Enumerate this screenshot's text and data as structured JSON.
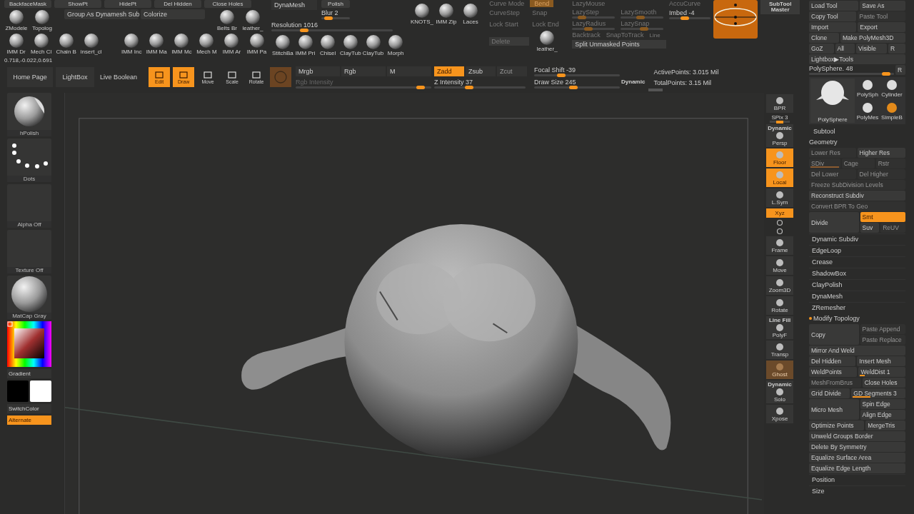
{
  "top_shelf": {
    "cut_buttons": [
      "BackfaceMask",
      "ShowPt",
      "HidePt",
      "Del Hidden",
      "Close Holes"
    ],
    "tiles_a": [
      "ZModele",
      "Topolog"
    ],
    "buttons": [
      "Group As Dynamesh Sub",
      "Colorize"
    ],
    "tiles_b": [
      "Belts Br",
      "leather_"
    ],
    "tiles_c": [
      "IMM Dr",
      "Mech Cl",
      "Chain B",
      "insert_cl"
    ],
    "tiles_d": [
      "IMM Inc",
      "IMM Ma",
      "IMM Mc",
      "Mech M",
      "IMM Ar",
      "IMM Pa"
    ],
    "coordinates": "0.718,-0.022,0.691"
  },
  "dynamesh": {
    "title": "DynaMesh",
    "polish": "Polish",
    "blur": {
      "label": "Blur 2",
      "level": 0.15
    },
    "resolution": {
      "label": "Resolution 1016",
      "level": 0.25
    },
    "brushes": [
      "StitchBa",
      "IMM Pri",
      "Chisel",
      "ClayTub",
      "ClayTub",
      "Morph"
    ]
  },
  "brushes_top": [
    "KNOTS_",
    "IMM Zip",
    "Laces"
  ],
  "stroke": {
    "curve_mode": "Curve Mode",
    "bend": {
      "label": "Bend",
      "on": true
    },
    "labels": [
      "CurveStep",
      "Snap",
      "Lock Start",
      "Lock End"
    ],
    "delete": "Delete",
    "tile": "leather_"
  },
  "lazy": {
    "title": "LazyMouse",
    "sliders": [
      {
        "label": "LazyStep",
        "level": 0.15
      },
      {
        "label": "LazySmooth",
        "level": 0.45
      },
      {
        "label": "LazyRadius",
        "level": 0.35
      },
      {
        "label": "LazySnap",
        "level": 0.55
      }
    ],
    "backtrack": "Backtrack",
    "snap_to_track": "SnapToTrack",
    "line": "Line",
    "split": "Split Unmasked Points"
  },
  "accucurve": "AccuCurve",
  "imbed": {
    "label": "Imbed -4",
    "level": 0.35
  },
  "subtool_master": "SubTool Master",
  "toolbar": {
    "home": "Home Page",
    "lightbox": "LightBox",
    "live_boolean": "Live Boolean",
    "modes": [
      {
        "label": "Edit",
        "on": true
      },
      {
        "label": "Draw",
        "on": true
      },
      {
        "label": "Move",
        "on": false
      },
      {
        "label": "Scale",
        "on": false
      },
      {
        "label": "Rotate",
        "on": false
      }
    ],
    "color_modes": [
      {
        "label": "Mrgb",
        "selected": false
      },
      {
        "label": "Rgb",
        "selected": false
      },
      {
        "label": "M",
        "selected": false
      }
    ],
    "rgb_intensity": {
      "label": "Rgb Intensity",
      "level": 0.95
    },
    "z_modes": [
      {
        "label": "Zadd",
        "selected": true
      },
      {
        "label": "Zsub",
        "selected": false
      },
      {
        "label": "Zcut",
        "selected": false
      }
    ],
    "z_intensity": {
      "label": "Z Intensity 37",
      "level": 0.37
    },
    "focal_shift": {
      "label": "Focal Shift -39",
      "level": 0.3
    },
    "draw_size": {
      "label": "Draw Size 245",
      "level": 0.45
    },
    "dynamic": "Dynamic",
    "active_points": "ActivePoints: 3.015 Mil",
    "total_points": "TotalPoints: 3.15 Mil"
  },
  "left_shelf": {
    "tiles": [
      {
        "kind": "brush",
        "label": "hPolish"
      },
      {
        "kind": "stroke",
        "label": "Dots"
      },
      {
        "kind": "alpha",
        "label": "Alpha Off"
      },
      {
        "kind": "texture",
        "label": "Texture Off"
      },
      {
        "kind": "material",
        "label": "MatCap Gray"
      }
    ],
    "gradient": "Gradient",
    "swatches": [
      {
        "color": "#000000"
      },
      {
        "color": "#ffffff"
      }
    ],
    "switch_color": "SwitchColor",
    "alternate": {
      "label": "Alternate",
      "on": true
    }
  },
  "right_shelf": [
    {
      "kind": "bpr",
      "label": "BPR",
      "on": false
    },
    {
      "kind": "slider",
      "label": "SPix 3",
      "level": 0.5
    },
    {
      "kind": "persp",
      "label": "Persp",
      "caption": "Dynamic",
      "on": false
    },
    {
      "kind": "floor",
      "label": "Floor",
      "on": true
    },
    {
      "kind": "local",
      "label": "Local",
      "on": true
    },
    {
      "kind": "lsym",
      "label": "L.Sym",
      "on": false
    },
    {
      "kind": "xyz",
      "label": "Xyz",
      "on": true
    },
    {
      "kind": "rot",
      "on": false
    },
    {
      "kind": "rot",
      "on": false
    },
    {
      "kind": "frame",
      "label": "Frame",
      "on": false
    },
    {
      "kind": "move",
      "label": "Move",
      "on": false
    },
    {
      "kind": "zoom",
      "label": "Zoom3D",
      "on": false
    },
    {
      "kind": "rotate",
      "label": "Rotate",
      "on": false
    },
    {
      "kind": "polyf",
      "label": "PolyF",
      "caption": "Line Fill",
      "on": false
    },
    {
      "kind": "transp",
      "label": "Transp",
      "on": false
    },
    {
      "kind": "ghost",
      "label": "Ghost",
      "on": true
    },
    {
      "kind": "solo",
      "label": "Solo",
      "caption": "Dynamic",
      "on": false
    },
    {
      "kind": "xpose",
      "label": "Xpose",
      "on": false
    }
  ],
  "tool_panel": {
    "rows": [
      [
        {
          "label": "Load Tool",
          "on": false,
          "disabled": false
        },
        {
          "label": "Save As",
          "on": false,
          "disabled": false
        }
      ],
      [
        {
          "label": "Copy Tool",
          "on": false,
          "disabled": false
        },
        {
          "label": "Paste Tool",
          "on": false,
          "disabled": true
        }
      ],
      [
        {
          "label": "Import",
          "on": false,
          "disabled": false
        },
        {
          "label": "Export",
          "on": false,
          "disabled": false
        }
      ],
      [
        {
          "label": "Clone",
          "on": false,
          "disabled": false
        },
        {
          "label": "Make PolyMesh3D",
          "on": false,
          "disabled": false
        }
      ],
      [
        {
          "label": "GoZ",
          "on": false,
          "disabled": false
        },
        {
          "label": "All",
          "on": false,
          "disabled": false
        },
        {
          "label": "Visible",
          "on": false,
          "disabled": false
        },
        {
          "label": "R",
          "on": false,
          "disabled": false
        }
      ],
      [
        {
          "label": "Lightbox▶Tools",
          "on": false,
          "disabled": false
        }
      ]
    ],
    "tool_slider": {
      "label": "PolySphere. 48",
      "level": 0.95
    },
    "tool_r": "R",
    "current_tool": "PolySphere",
    "tools": [
      "PolySph",
      "Cylinder",
      "PolyMes",
      "SimpleB"
    ]
  },
  "subtool_panel": [
    {
      "kind": "header",
      "label": "Subtool"
    },
    {
      "kind": "section",
      "label": "Geometry",
      "marked": false
    },
    {
      "kind": "buttons",
      "buttons": [
        {
          "label": "Lower Res",
          "on": false,
          "disabled": true
        },
        {
          "label": "Higher Res",
          "on": false,
          "disabled": false
        }
      ]
    },
    {
      "kind": "buttons",
      "buttons": [
        {
          "label": "SDiv",
          "on": false,
          "disabled": true,
          "level": 1
        },
        {
          "label": "Cage",
          "on": false,
          "disabled": true
        },
        {
          "label": "Rstr",
          "on": false,
          "disabled": true
        }
      ]
    },
    {
      "kind": "buttons",
      "buttons": [
        {
          "label": "Del Lower",
          "on": false,
          "disabled": true
        },
        {
          "label": "Del Higher",
          "on": false,
          "disabled": true
        }
      ]
    },
    {
      "kind": "buttons",
      "buttons": [
        {
          "label": "Freeze SubDivision Levels",
          "on": false,
          "disabled": true
        }
      ]
    },
    {
      "kind": "buttons",
      "buttons": [
        {
          "label": "Reconstruct Subdiv",
          "on": false,
          "disabled": false
        }
      ]
    },
    {
      "kind": "buttons",
      "buttons": [
        {
          "label": "Convert BPR To Geo",
          "on": false,
          "disabled": true
        }
      ]
    },
    {
      "kind": "split",
      "main": {
        "label": "Divide",
        "on": false,
        "disabled": false
      },
      "rows": [
        [
          {
            "label": "Smt",
            "on": true,
            "disabled": false
          }
        ],
        [
          {
            "label": "Suv",
            "on": false,
            "disabled": false
          },
          {
            "label": "ReUV",
            "on": false,
            "disabled": true
          }
        ]
      ]
    },
    {
      "kind": "item",
      "label": "Dynamic Subdiv"
    },
    {
      "kind": "item",
      "label": "EdgeLoop"
    },
    {
      "kind": "item",
      "label": "Crease"
    },
    {
      "kind": "item",
      "label": "ShadowBox"
    },
    {
      "kind": "item",
      "label": "ClayPolish"
    },
    {
      "kind": "item",
      "label": "DynaMesh"
    },
    {
      "kind": "item",
      "label": "ZRemesher"
    },
    {
      "kind": "section",
      "label": "Modify Topology",
      "marked": true
    },
    {
      "kind": "split",
      "main": {
        "label": "Copy",
        "on": false,
        "disabled": false
      },
      "rows": [
        [
          {
            "label": "Paste Append",
            "on": false,
            "disabled": true
          }
        ],
        [
          {
            "label": "Paste Replace",
            "on": false,
            "disabled": true
          }
        ]
      ]
    },
    {
      "kind": "buttons",
      "buttons": [
        {
          "label": "Mirror And Weld",
          "on": false,
          "disabled": false
        }
      ]
    },
    {
      "kind": "buttons",
      "buttons": [
        {
          "label": "Del Hidden",
          "on": false,
          "disabled": false
        },
        {
          "label": "Insert Mesh",
          "on": false,
          "disabled": false
        }
      ]
    },
    {
      "kind": "buttons",
      "buttons": [
        {
          "label": "WeldPoints",
          "on": false,
          "disabled": false
        },
        {
          "label": "WeldDist 1",
          "on": false,
          "disabled": false,
          "level": 0.1
        }
      ]
    },
    {
      "kind": "buttons",
      "buttons": [
        {
          "label": "MeshFromBrus",
          "on": false,
          "disabled": true
        },
        {
          "label": "Close Holes",
          "on": false,
          "disabled": false
        }
      ]
    },
    {
      "kind": "buttons",
      "buttons": [
        {
          "label": "Grid Divide",
          "on": false,
          "disabled": false
        },
        {
          "label": "GD Segments 3",
          "on": false,
          "disabled": false,
          "level": 0.35
        }
      ]
    },
    {
      "kind": "split",
      "main": {
        "label": "Micro Mesh",
        "on": false,
        "disabled": false
      },
      "rows": [
        [
          {
            "label": "Spin Edge",
            "on": false,
            "disabled": false
          }
        ],
        [
          {
            "label": "Align Edge",
            "on": false,
            "disabled": false
          }
        ]
      ]
    },
    {
      "kind": "buttons",
      "buttons": [
        {
          "label": "Optimize Points",
          "on": false,
          "disabled": false
        },
        {
          "label": "MergeTris",
          "on": false,
          "disabled": false
        }
      ]
    },
    {
      "kind": "buttons",
      "buttons": [
        {
          "label": "Unweld Groups Border",
          "on": false,
          "disabled": false
        }
      ]
    },
    {
      "kind": "buttons",
      "buttons": [
        {
          "label": "Delete By Symmetry",
          "on": false,
          "disabled": false
        }
      ]
    },
    {
      "kind": "buttons",
      "buttons": [
        {
          "label": "Equalize Surface Area",
          "on": false,
          "disabled": false
        }
      ]
    },
    {
      "kind": "buttons",
      "buttons": [
        {
          "label": "Equalize Edge Length",
          "on": false,
          "disabled": false
        }
      ]
    },
    {
      "kind": "item",
      "label": "Position"
    },
    {
      "kind": "item",
      "label": "Size"
    }
  ]
}
